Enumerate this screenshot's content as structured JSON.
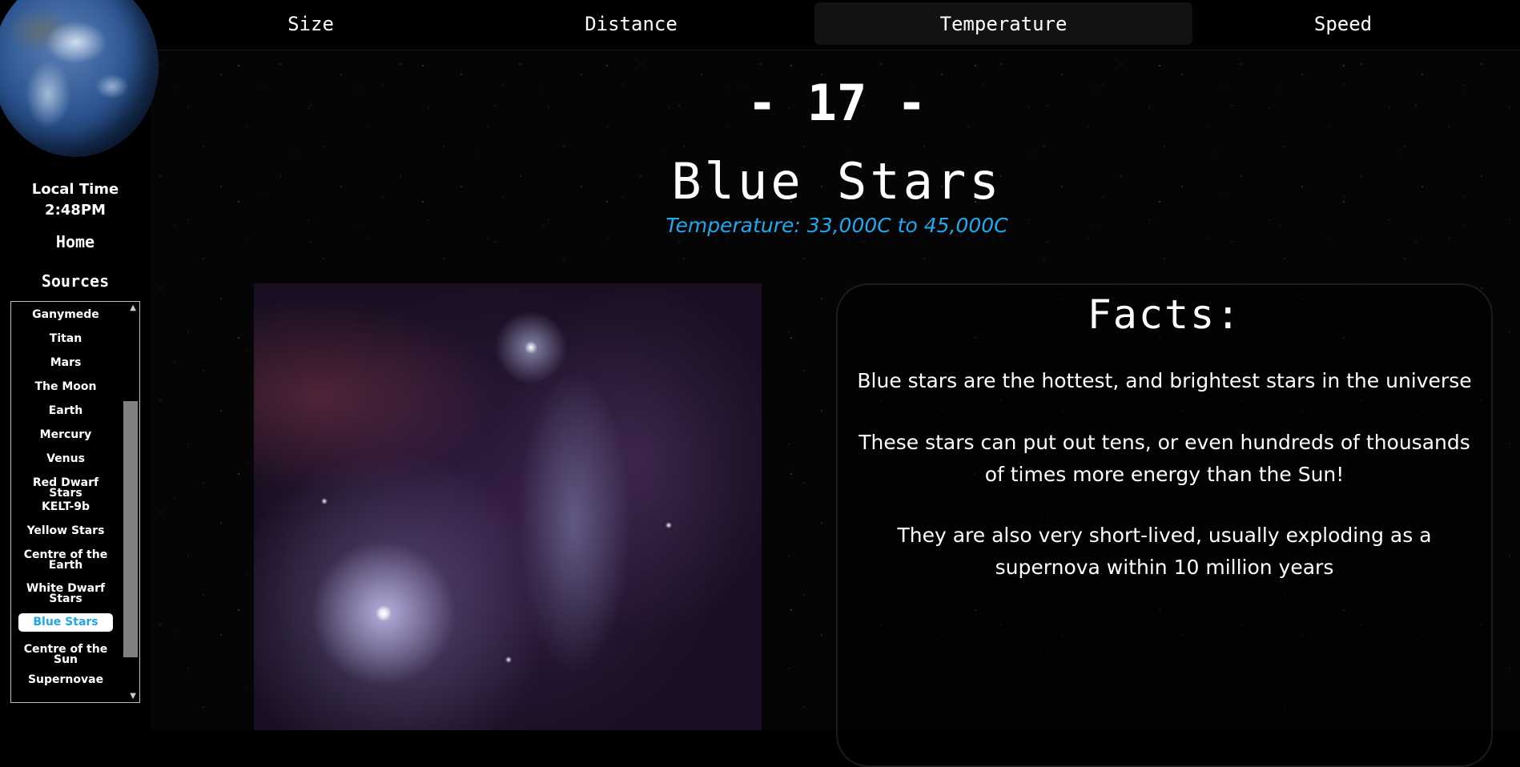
{
  "nav": {
    "tabs": [
      {
        "label": "Size"
      },
      {
        "label": "Distance"
      },
      {
        "label": "Temperature"
      },
      {
        "label": "Speed"
      }
    ],
    "active_tab": "Temperature"
  },
  "sidebar": {
    "local_time_label": "Local Time",
    "local_time_value": "2:48PM",
    "home_label": "Home",
    "sources_label": "Sources",
    "list_items": [
      {
        "label": "Ganymede"
      },
      {
        "label": "Titan"
      },
      {
        "label": "Mars"
      },
      {
        "label": "The Moon"
      },
      {
        "label": "Earth"
      },
      {
        "label": "Mercury"
      },
      {
        "label": "Venus"
      },
      {
        "label": "Red Dwarf Stars"
      },
      {
        "label": "KELT-9b"
      },
      {
        "label": "Yellow Stars"
      },
      {
        "label": "Centre of the Earth"
      },
      {
        "label": "White Dwarf Stars"
      },
      {
        "label": "Blue Stars"
      },
      {
        "label": "Centre of the Sun"
      },
      {
        "label": "Supernovae"
      }
    ],
    "selected_item": "Blue Stars"
  },
  "main": {
    "number": "- 17 -",
    "title": "Blue Stars",
    "subtitle": "Temperature: 33,000C to 45,000C",
    "facts_title": "Facts:",
    "facts": [
      "Blue stars are the hottest, and brightest stars in the universe",
      "These stars can put out tens, or even hundreds of thousands of times more energy than the Sun!",
      "They are also very short-lived, usually exploding as a supernova within 10 million years"
    ]
  },
  "colors": {
    "accent": "#22a8ee",
    "background": "#000000",
    "active_tab_bg": "#121212"
  }
}
